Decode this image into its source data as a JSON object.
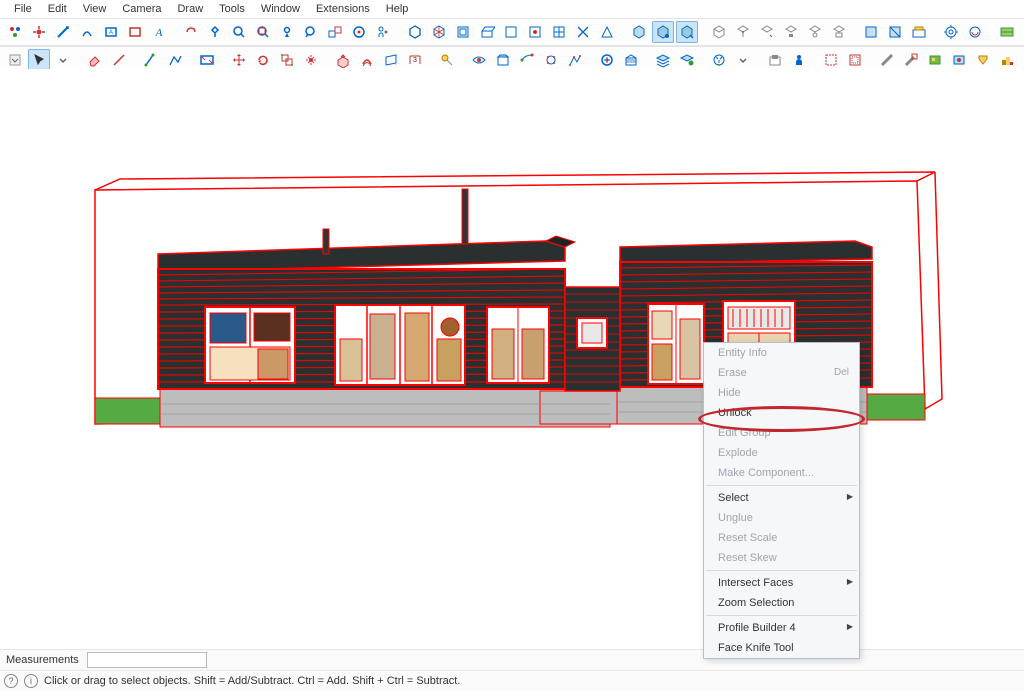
{
  "menubar": [
    "File",
    "Edit",
    "View",
    "Camera",
    "Draw",
    "Tools",
    "Window",
    "Extensions",
    "Help"
  ],
  "context_menu": {
    "items": [
      {
        "label": "Entity Info",
        "disabled": true
      },
      {
        "label": "Erase",
        "disabled": true,
        "shortcut": "Del"
      },
      {
        "label": "Hide",
        "disabled": true
      },
      {
        "label": "Unlock",
        "disabled": false
      },
      {
        "label": "Edit Group",
        "disabled": true
      },
      {
        "label": "Explode",
        "disabled": true
      },
      {
        "label": "Make Component...",
        "disabled": true
      },
      {
        "sep": true
      },
      {
        "label": "Select",
        "submenu": true,
        "disabled": false
      },
      {
        "label": "Unglue",
        "disabled": true
      },
      {
        "label": "Reset Scale",
        "disabled": true
      },
      {
        "label": "Reset Skew",
        "disabled": true
      },
      {
        "sep": true
      },
      {
        "label": "Intersect Faces",
        "submenu": true,
        "disabled": false
      },
      {
        "label": "Zoom Selection",
        "disabled": false
      },
      {
        "sep": true
      },
      {
        "label": "Profile Builder 4",
        "submenu": true,
        "disabled": false
      },
      {
        "label": "Face Knife Tool",
        "disabled": false
      }
    ]
  },
  "status": {
    "measurements_label": "Measurements",
    "hint": "Click or drag to select objects. Shift = Add/Subtract. Ctrl = Add. Shift + Ctrl = Subtract."
  },
  "icons": {
    "help": "?",
    "info": "i"
  }
}
